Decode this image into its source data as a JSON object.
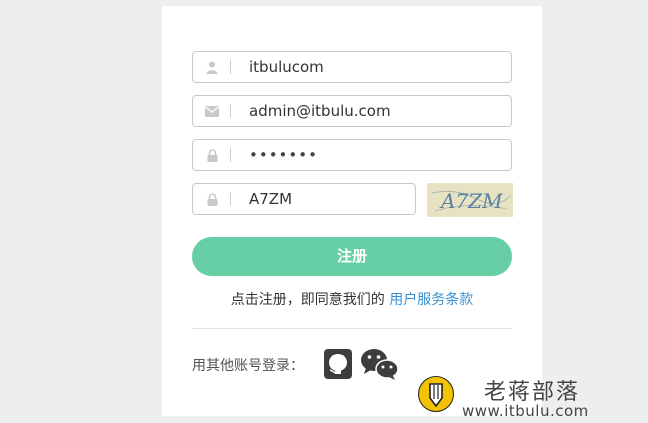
{
  "form": {
    "username": "itbulucom",
    "email": "admin@itbulu.com",
    "password": "•••••••",
    "captcha_input": "A7ZM",
    "captcha_image_text": "A7ZM",
    "submit_label": "注册",
    "terms_prefix": "点击注册，即同意我们的",
    "terms_link": "用户服务条款"
  },
  "social": {
    "label": "用其他账号登录："
  },
  "watermark": {
    "title": "老蒋部落",
    "url": "www.itbulu.com"
  },
  "colors": {
    "accent": "#67cfa5",
    "link": "#3a8fd0"
  }
}
